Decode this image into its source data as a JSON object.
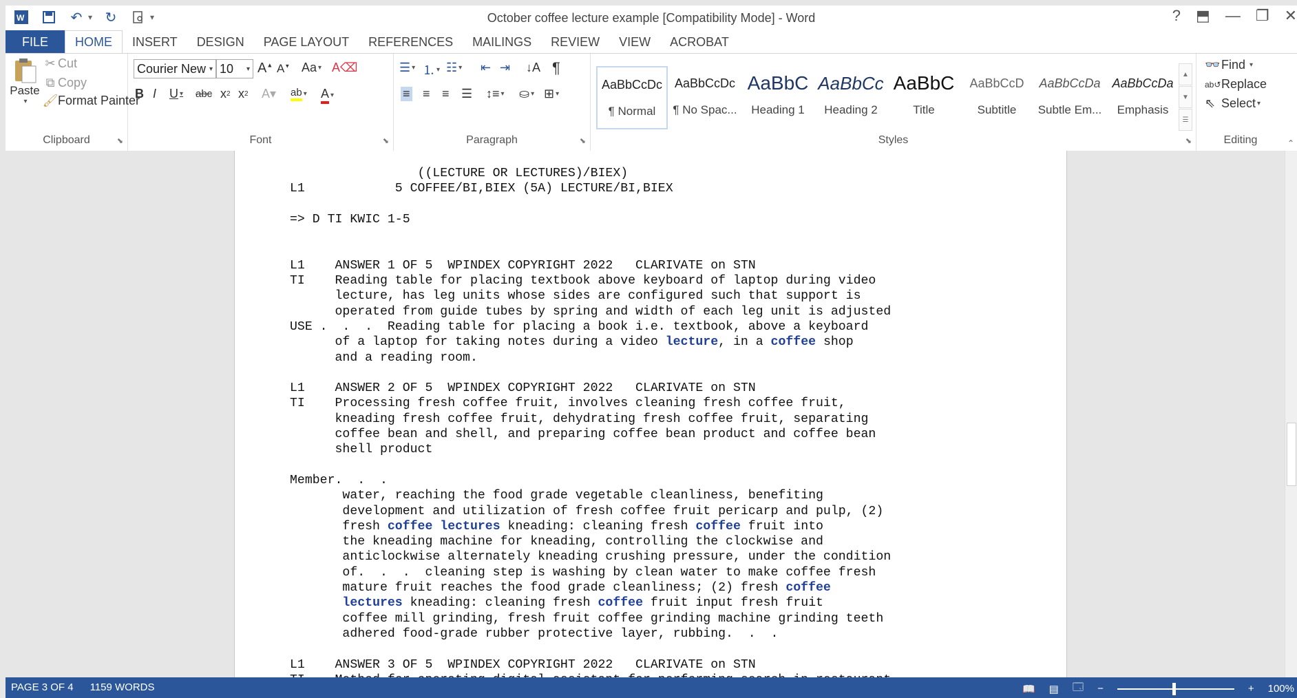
{
  "window": {
    "title": "October coffee lecture example [Compatibility Mode] - Word",
    "help": "?"
  },
  "tabs": {
    "file": "FILE",
    "items": [
      "HOME",
      "INSERT",
      "DESIGN",
      "PAGE LAYOUT",
      "REFERENCES",
      "MAILINGS",
      "REVIEW",
      "VIEW",
      "ACROBAT"
    ],
    "active": "HOME"
  },
  "clipboard": {
    "paste": "Paste",
    "cut": "Cut",
    "copy": "Copy",
    "format_painter": "Format Painter",
    "label": "Clipboard"
  },
  "font": {
    "name": "Courier New",
    "size": "10",
    "change_case": "Aa",
    "bold": "B",
    "italic": "I",
    "underline": "U",
    "strike": "abc",
    "subscript": "x",
    "superscript": "x",
    "label": "Font"
  },
  "paragraph": {
    "label": "Paragraph"
  },
  "styles": {
    "items": [
      {
        "preview": "AaBbCcDc",
        "name": "¶ Normal"
      },
      {
        "preview": "AaBbCcDc",
        "name": "¶ No Spac..."
      },
      {
        "preview": "AaBbC",
        "name": "Heading 1"
      },
      {
        "preview": "AaBbCc",
        "name": "Heading 2"
      },
      {
        "preview": "AaBbC",
        "name": "Title"
      },
      {
        "preview": "AaBbCcD",
        "name": "Subtitle"
      },
      {
        "preview": "AaBbCcDa",
        "name": "Subtle Em..."
      },
      {
        "preview": "AaBbCcDa",
        "name": "Emphasis"
      }
    ],
    "label": "Styles"
  },
  "editing": {
    "find": "Find",
    "replace": "Replace",
    "select": "Select",
    "label": "Editing"
  },
  "document": {
    "lines": [
      [
        {
          "t": "                 ((LECTURE OR LECTURES)/BIEX)"
        }
      ],
      [
        {
          "t": "L1            5 COFFEE/BI,BIEX (5A) LECTURE/BI,BIEX"
        }
      ],
      [
        {
          "t": ""
        }
      ],
      [
        {
          "t": "=> D TI KWIC 1-5"
        }
      ],
      [
        {
          "t": ""
        }
      ],
      [
        {
          "t": ""
        }
      ],
      [
        {
          "t": "L1    ANSWER 1 OF 5  WPINDEX COPYRIGHT 2022   CLARIVATE on STN"
        }
      ],
      [
        {
          "t": "TI    Reading table for placing textbook above keyboard of laptop during video"
        }
      ],
      [
        {
          "t": "      lecture, has leg units whose sides are configured such that support is"
        }
      ],
      [
        {
          "t": "      operated from guide tubes by spring and width of each leg unit is adjusted"
        }
      ],
      [
        {
          "t": "USE .  .  .  Reading table for placing a book i.e. textbook, above a keyboard"
        }
      ],
      [
        {
          "t": "      of a laptop for taking notes during a video "
        },
        {
          "t": "lecture",
          "h": true
        },
        {
          "t": ", in a "
        },
        {
          "t": "coffee",
          "h": true
        },
        {
          "t": " shop"
        }
      ],
      [
        {
          "t": "      and a reading room."
        }
      ],
      [
        {
          "t": ""
        }
      ],
      [
        {
          "t": "L1    ANSWER 2 OF 5  WPINDEX COPYRIGHT 2022   CLARIVATE on STN"
        }
      ],
      [
        {
          "t": "TI    Processing fresh coffee fruit, involves cleaning fresh coffee fruit,"
        }
      ],
      [
        {
          "t": "      kneading fresh coffee fruit, dehydrating fresh coffee fruit, separating"
        }
      ],
      [
        {
          "t": "      coffee bean and shell, and preparing coffee bean product and coffee bean"
        }
      ],
      [
        {
          "t": "      shell product"
        }
      ],
      [
        {
          "t": ""
        }
      ],
      [
        {
          "t": "Member.  .  ."
        }
      ],
      [
        {
          "t": "       water, reaching the food grade vegetable cleanliness, benefiting"
        }
      ],
      [
        {
          "t": "       development and utilization of fresh coffee fruit pericarp and pulp, (2)"
        }
      ],
      [
        {
          "t": "       fresh "
        },
        {
          "t": "coffee lectures",
          "h": true
        },
        {
          "t": " kneading: cleaning fresh "
        },
        {
          "t": "coffee",
          "h": true
        },
        {
          "t": " fruit into"
        }
      ],
      [
        {
          "t": "       the kneading machine for kneading, controlling the clockwise and"
        }
      ],
      [
        {
          "t": "       anticlockwise alternately kneading crushing pressure, under the condition"
        }
      ],
      [
        {
          "t": "       of.  .  .  cleaning step is washing by clean water to make coffee fresh"
        }
      ],
      [
        {
          "t": "       mature fruit reaches the food grade cleanliness; (2) fresh "
        },
        {
          "t": "coffee",
          "h": true
        }
      ],
      [
        {
          "t": "       "
        },
        {
          "t": "lectures",
          "h": true
        },
        {
          "t": " kneading: cleaning fresh "
        },
        {
          "t": "coffee",
          "h": true
        },
        {
          "t": " fruit input fresh fruit"
        }
      ],
      [
        {
          "t": "       coffee mill grinding, fresh fruit coffee grinding machine grinding teeth"
        }
      ],
      [
        {
          "t": "       adhered food-grade rubber protective layer, rubbing.  .  ."
        }
      ],
      [
        {
          "t": ""
        }
      ],
      [
        {
          "t": "L1    ANSWER 3 OF 5  WPINDEX COPYRIGHT 2022   CLARIVATE on STN"
        }
      ],
      [
        {
          "t": "TI    Method for operating digital assistant for performing search in restaurant"
        }
      ]
    ]
  },
  "status": {
    "page": "PAGE 3 OF 4",
    "words": "1159 WORDS",
    "zoom": "100%",
    "zoom_level_percent": 100
  },
  "colors": {
    "brand": "#2b579a",
    "highlight": "#1f3f9b"
  }
}
